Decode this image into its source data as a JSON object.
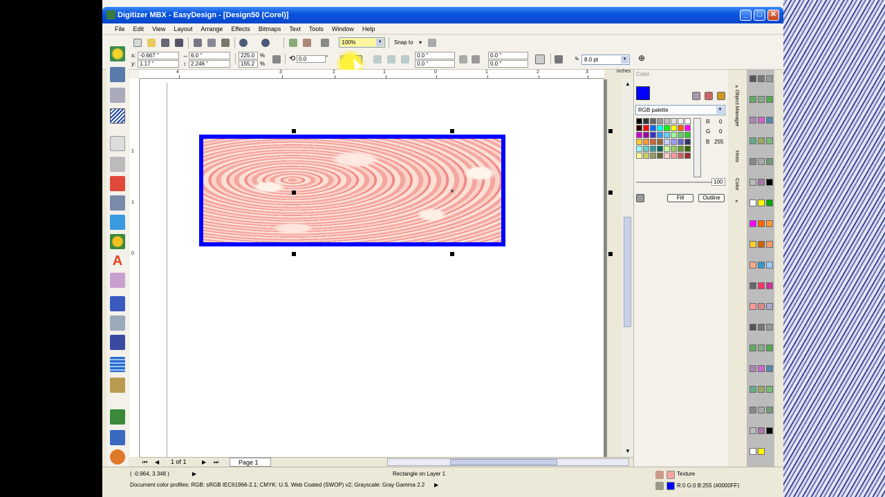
{
  "window": {
    "title": "Digitizer MBX - EasyDesign - [Design50 (Corel)]"
  },
  "menu": [
    "File",
    "Edit",
    "View",
    "Layout",
    "Arrange",
    "Effects",
    "Bitmaps",
    "Text",
    "Tools",
    "Window",
    "Help"
  ],
  "toolbar": {
    "zoom": "100%",
    "snap_to": "Snap to"
  },
  "propbar": {
    "x_label": "x:",
    "x": "-0.667 \"",
    "y_label": "y:",
    "y": "1.17 \"",
    "w": "6.0 \"",
    "h": "2.246 \"",
    "sx": "225.0",
    "sy": "155.2",
    "pct1": "%",
    "pct2": "%",
    "rotation": "0.0",
    "deg": "°",
    "c1": "0.0 \"",
    "c2": "0.0 \"",
    "c3": "0.0 \"",
    "c4": "0.0 \"",
    "outline_width": "8.0 pt"
  },
  "ruler": {
    "unit": "inches",
    "top": [
      "4",
      "3",
      "2",
      "1",
      "0",
      "1",
      "2",
      "3"
    ],
    "left": [
      "2",
      "1",
      "0"
    ]
  },
  "page_nav": {
    "count": "1 of 1",
    "tab": "Page 1"
  },
  "docker": {
    "title": "Color",
    "palette_select": "RGB palette",
    "r_label": "R",
    "r": "0",
    "g_label": "G",
    "g": "0",
    "b_label": "B",
    "b": "255",
    "opacity": "100",
    "fill_button": "Fill",
    "outline_button": "Outline",
    "tabs": [
      "Object Manager",
      "Hints",
      "Color"
    ],
    "accent": "#0000ff"
  },
  "status": {
    "coords": "( -0.964, 3.348 )",
    "object": "Rectangle on Layer 1",
    "fill": "Texture",
    "outline": "R:0 G:0 B:255 (#0000FF)",
    "profiles": "Document color profiles: RGB: sRGB IEC61966-2.1; CMYK: U.S. Web Coated (SWOP) v2; Grayscale: Gray Gamma 2.2"
  }
}
